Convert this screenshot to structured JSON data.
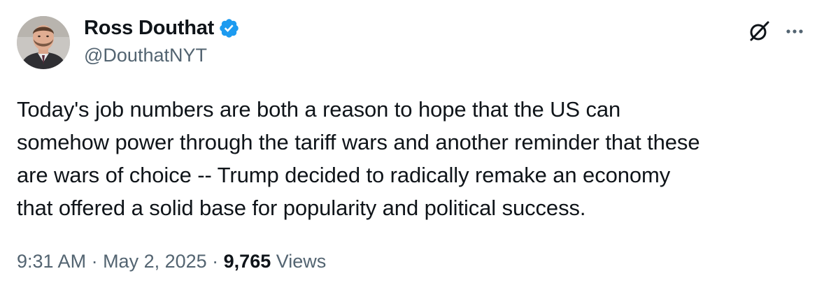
{
  "author": {
    "display_name": "Ross Douthat",
    "handle": "@DouthatNYT",
    "verified_badge_icon": "verified-badge-icon",
    "verified_color": "#1d9bf0"
  },
  "header_actions": {
    "grok_icon": "grok-icon",
    "more_icon": "more-options-icon"
  },
  "tweet": {
    "lines": [
      "Today's job numbers are both a reason to hope that the US can",
      "somehow power through the tariff wars and another reminder that these",
      "are wars of choice -- Trump decided to radically remake an economy",
      "that offered a solid base for popularity and political success."
    ]
  },
  "meta": {
    "time": "9:31 AM",
    "separator": " · ",
    "date": "May 2, 2025",
    "views_count": "9,765",
    "views_label": " Views"
  },
  "colors": {
    "text_primary": "#0f1419",
    "text_secondary": "#536471",
    "accent": "#1d9bf0"
  }
}
